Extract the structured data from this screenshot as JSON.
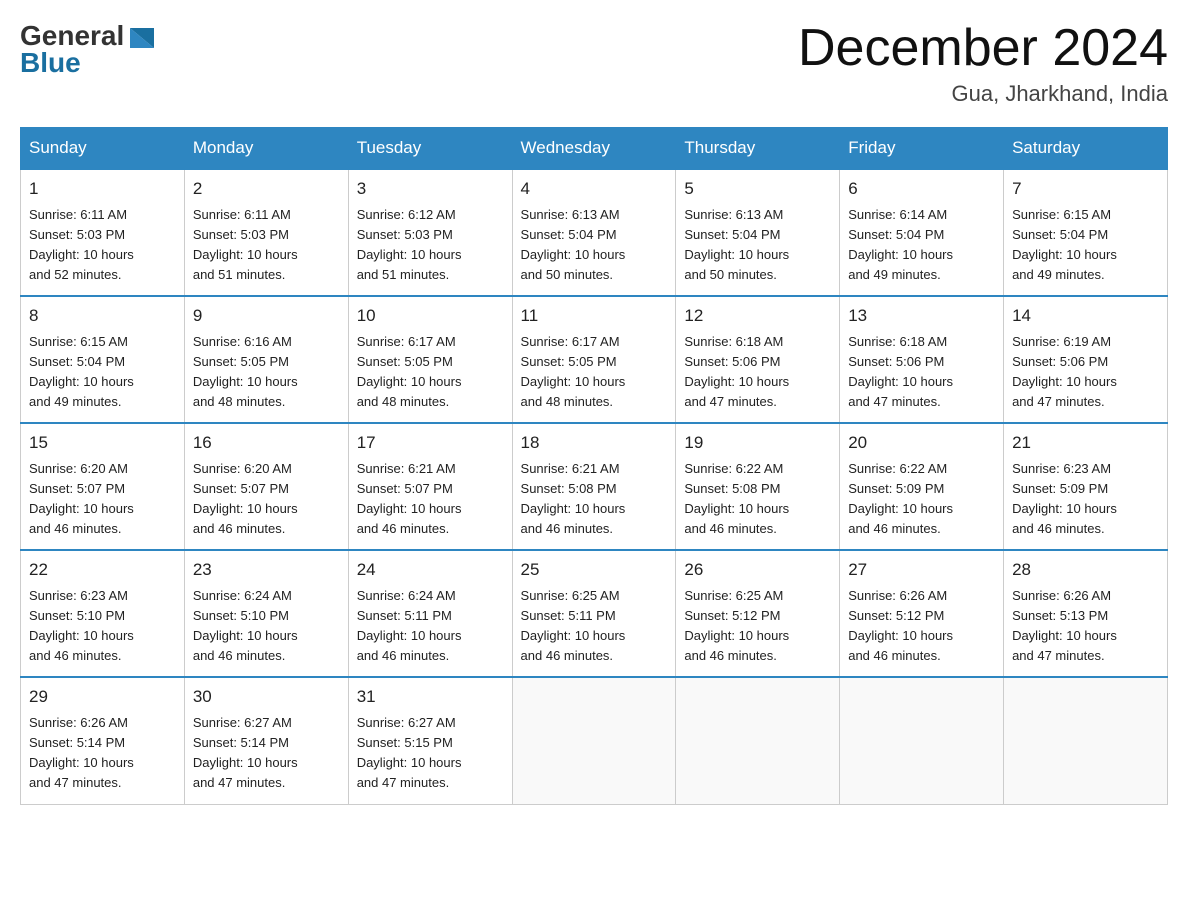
{
  "header": {
    "logo": {
      "general": "General",
      "blue": "Blue"
    },
    "title": "December 2024",
    "location": "Gua, Jharkhand, India"
  },
  "weekdays": [
    "Sunday",
    "Monday",
    "Tuesday",
    "Wednesday",
    "Thursday",
    "Friday",
    "Saturday"
  ],
  "weeks": [
    [
      {
        "day": "1",
        "sunrise": "6:11 AM",
        "sunset": "5:03 PM",
        "daylight": "10 hours and 52 minutes."
      },
      {
        "day": "2",
        "sunrise": "6:11 AM",
        "sunset": "5:03 PM",
        "daylight": "10 hours and 51 minutes."
      },
      {
        "day": "3",
        "sunrise": "6:12 AM",
        "sunset": "5:03 PM",
        "daylight": "10 hours and 51 minutes."
      },
      {
        "day": "4",
        "sunrise": "6:13 AM",
        "sunset": "5:04 PM",
        "daylight": "10 hours and 50 minutes."
      },
      {
        "day": "5",
        "sunrise": "6:13 AM",
        "sunset": "5:04 PM",
        "daylight": "10 hours and 50 minutes."
      },
      {
        "day": "6",
        "sunrise": "6:14 AM",
        "sunset": "5:04 PM",
        "daylight": "10 hours and 49 minutes."
      },
      {
        "day": "7",
        "sunrise": "6:15 AM",
        "sunset": "5:04 PM",
        "daylight": "10 hours and 49 minutes."
      }
    ],
    [
      {
        "day": "8",
        "sunrise": "6:15 AM",
        "sunset": "5:04 PM",
        "daylight": "10 hours and 49 minutes."
      },
      {
        "day": "9",
        "sunrise": "6:16 AM",
        "sunset": "5:05 PM",
        "daylight": "10 hours and 48 minutes."
      },
      {
        "day": "10",
        "sunrise": "6:17 AM",
        "sunset": "5:05 PM",
        "daylight": "10 hours and 48 minutes."
      },
      {
        "day": "11",
        "sunrise": "6:17 AM",
        "sunset": "5:05 PM",
        "daylight": "10 hours and 48 minutes."
      },
      {
        "day": "12",
        "sunrise": "6:18 AM",
        "sunset": "5:06 PM",
        "daylight": "10 hours and 47 minutes."
      },
      {
        "day": "13",
        "sunrise": "6:18 AM",
        "sunset": "5:06 PM",
        "daylight": "10 hours and 47 minutes."
      },
      {
        "day": "14",
        "sunrise": "6:19 AM",
        "sunset": "5:06 PM",
        "daylight": "10 hours and 47 minutes."
      }
    ],
    [
      {
        "day": "15",
        "sunrise": "6:20 AM",
        "sunset": "5:07 PM",
        "daylight": "10 hours and 46 minutes."
      },
      {
        "day": "16",
        "sunrise": "6:20 AM",
        "sunset": "5:07 PM",
        "daylight": "10 hours and 46 minutes."
      },
      {
        "day": "17",
        "sunrise": "6:21 AM",
        "sunset": "5:07 PM",
        "daylight": "10 hours and 46 minutes."
      },
      {
        "day": "18",
        "sunrise": "6:21 AM",
        "sunset": "5:08 PM",
        "daylight": "10 hours and 46 minutes."
      },
      {
        "day": "19",
        "sunrise": "6:22 AM",
        "sunset": "5:08 PM",
        "daylight": "10 hours and 46 minutes."
      },
      {
        "day": "20",
        "sunrise": "6:22 AM",
        "sunset": "5:09 PM",
        "daylight": "10 hours and 46 minutes."
      },
      {
        "day": "21",
        "sunrise": "6:23 AM",
        "sunset": "5:09 PM",
        "daylight": "10 hours and 46 minutes."
      }
    ],
    [
      {
        "day": "22",
        "sunrise": "6:23 AM",
        "sunset": "5:10 PM",
        "daylight": "10 hours and 46 minutes."
      },
      {
        "day": "23",
        "sunrise": "6:24 AM",
        "sunset": "5:10 PM",
        "daylight": "10 hours and 46 minutes."
      },
      {
        "day": "24",
        "sunrise": "6:24 AM",
        "sunset": "5:11 PM",
        "daylight": "10 hours and 46 minutes."
      },
      {
        "day": "25",
        "sunrise": "6:25 AM",
        "sunset": "5:11 PM",
        "daylight": "10 hours and 46 minutes."
      },
      {
        "day": "26",
        "sunrise": "6:25 AM",
        "sunset": "5:12 PM",
        "daylight": "10 hours and 46 minutes."
      },
      {
        "day": "27",
        "sunrise": "6:26 AM",
        "sunset": "5:12 PM",
        "daylight": "10 hours and 46 minutes."
      },
      {
        "day": "28",
        "sunrise": "6:26 AM",
        "sunset": "5:13 PM",
        "daylight": "10 hours and 47 minutes."
      }
    ],
    [
      {
        "day": "29",
        "sunrise": "6:26 AM",
        "sunset": "5:14 PM",
        "daylight": "10 hours and 47 minutes."
      },
      {
        "day": "30",
        "sunrise": "6:27 AM",
        "sunset": "5:14 PM",
        "daylight": "10 hours and 47 minutes."
      },
      {
        "day": "31",
        "sunrise": "6:27 AM",
        "sunset": "5:15 PM",
        "daylight": "10 hours and 47 minutes."
      },
      null,
      null,
      null,
      null
    ]
  ],
  "labels": {
    "sunrise_prefix": "Sunrise: ",
    "sunset_prefix": "Sunset: ",
    "daylight_prefix": "Daylight: "
  }
}
